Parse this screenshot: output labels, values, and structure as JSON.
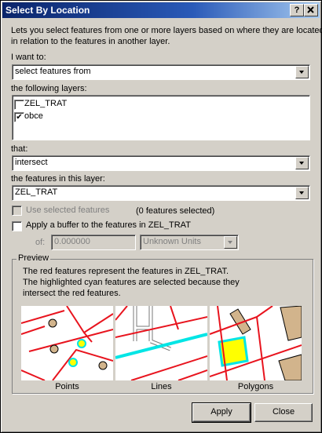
{
  "window": {
    "title": "Select By Location",
    "help_label": "?",
    "close_label": "X"
  },
  "description": {
    "line1": "Lets you select features from one or more layers based on where they are located",
    "line2": "in relation to the features in another layer."
  },
  "i_want_to": {
    "label": "I want to:",
    "value": "select features from"
  },
  "layers": {
    "label": "the following layers:",
    "items": [
      {
        "name": "ZEL_TRAT",
        "checked": false,
        "mark": ""
      },
      {
        "name": "obce",
        "checked": true,
        "mark": "✔"
      }
    ]
  },
  "that": {
    "label": "that:",
    "value": "intersect"
  },
  "target_layer": {
    "label": "the features in this layer:",
    "value": "ZEL_TRAT"
  },
  "use_selected": {
    "label": "Use selected features",
    "count_text": "(0 features selected)",
    "checked": false
  },
  "buffer": {
    "label": "Apply a buffer to the features in  ZEL_TRAT",
    "of_label": "of:",
    "distance": "0.000000",
    "units": "Unknown Units",
    "checked": false
  },
  "preview": {
    "title": "Preview",
    "line1": "The red features represent the features in ZEL_TRAT.",
    "line2": "The highlighted cyan features are selected because they",
    "line3": "intersect the red features.",
    "captions": [
      "Points",
      "Lines",
      "Polygons"
    ]
  },
  "buttons": {
    "apply": "Apply",
    "close": "Close"
  },
  "colors": {
    "red_feature": "#e8141e",
    "cyan_selected": "#00e5e5",
    "tan_feature": "#d2b48c",
    "yellow_highlight": "#ffff00"
  },
  "icons": {
    "dropdown": "chevron-down-icon",
    "check": "checkmark-icon"
  }
}
